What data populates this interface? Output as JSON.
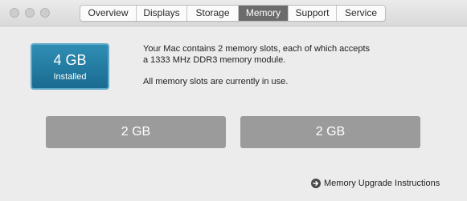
{
  "tabs": [
    {
      "label": "Overview",
      "active": false
    },
    {
      "label": "Displays",
      "active": false
    },
    {
      "label": "Storage",
      "active": false
    },
    {
      "label": "Memory",
      "active": true
    },
    {
      "label": "Support",
      "active": false
    },
    {
      "label": "Service",
      "active": false
    }
  ],
  "memory": {
    "installed_size": "4 GB",
    "installed_label": "Installed",
    "description_line1": "Your Mac contains 2 memory slots, each of which accepts",
    "description_line2": "a 1333 MHz DDR3 memory module.",
    "status_text": "All memory slots are currently in use.",
    "slots": [
      {
        "label": "2 GB"
      },
      {
        "label": "2 GB"
      }
    ],
    "upgrade_link_label": "Memory Upgrade Instructions"
  },
  "colors": {
    "active_tab": "#6b6b6b",
    "installed_box": "#1f7ba3",
    "slot": "#9b9b9b",
    "background": "#ececec"
  },
  "icons": {
    "upgrade_link_icon": "arrow-circle-right-icon"
  }
}
